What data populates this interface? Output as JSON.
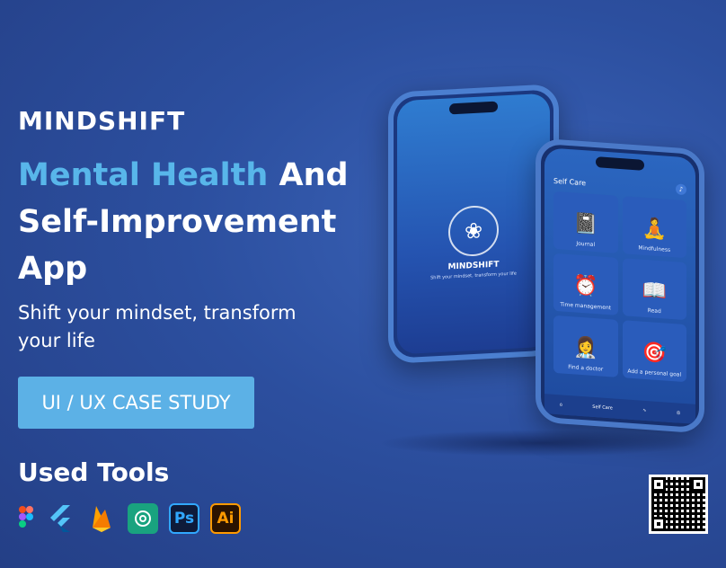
{
  "brand": "MINDSHIFT",
  "headline": {
    "accent": "Mental Health",
    "rest1": " And",
    "line2": "Self-Improvement",
    "line3": "App"
  },
  "tagline": "Shift your mindset, transform your life",
  "cta_label": "UI / UX CASE STUDY",
  "tools": {
    "title": "Used Tools",
    "items": [
      {
        "name": "figma-icon"
      },
      {
        "name": "flutter-icon"
      },
      {
        "name": "firebase-icon"
      },
      {
        "name": "chatgpt-icon"
      },
      {
        "name": "photoshop-icon",
        "label": "Ps"
      },
      {
        "name": "illustrator-icon",
        "label": "Ai"
      }
    ]
  },
  "phone_splash": {
    "name": "MINDSHIFT",
    "subtitle": "Shift your mindset, transform your life"
  },
  "phone_selfcare": {
    "title": "Self Care",
    "cards": [
      {
        "label": "Journal",
        "icon": "journal-icon"
      },
      {
        "label": "Mindfulness",
        "icon": "meditation-icon"
      },
      {
        "label": "Time management",
        "icon": "clock-icon"
      },
      {
        "label": "Read",
        "icon": "reading-icon"
      },
      {
        "label": "Find a doctor",
        "icon": "doctor-icon"
      },
      {
        "label": "Add a personal goal",
        "icon": "target-icon"
      }
    ],
    "tab_label": "Self Care"
  },
  "colors": {
    "accent": "#58b6ea",
    "cta_bg": "#5cb1e6",
    "background": "#2c4f9f"
  }
}
